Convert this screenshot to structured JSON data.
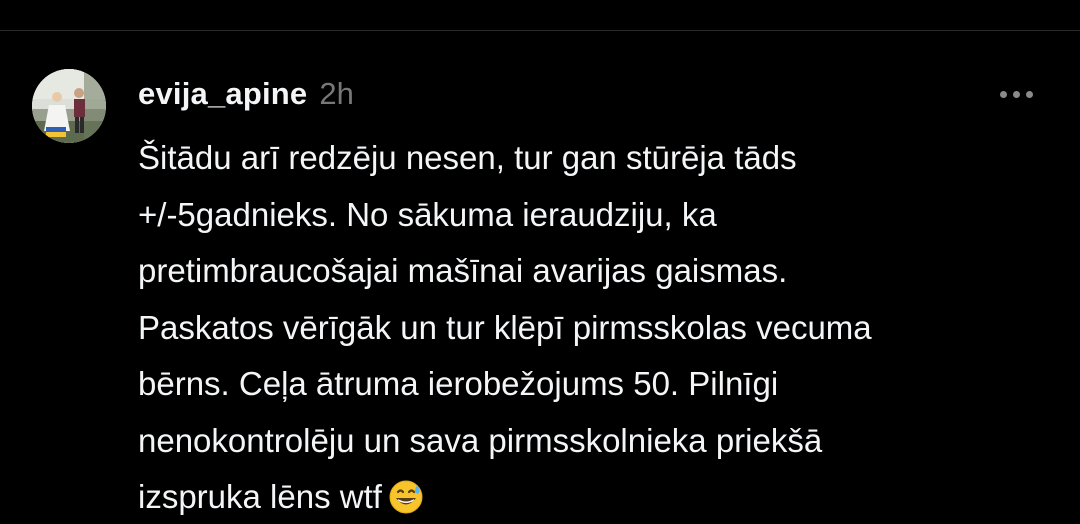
{
  "post": {
    "username": "evija_apine",
    "timestamp": "2h",
    "comment_lines": [
      "Šitādu arī redzēju nesen, tur gan stūrēja tāds",
      "+/-5gadnieks. No sākuma ieraudziju, ka",
      "pretimbraucošajai mašīnai avarijas gaismas.",
      "Paskatos vērīgāk un tur klēpī pirmsskolas vecuma",
      "bērns. Ceļa ātruma ierobežojums 50. Pilnīgi",
      "nenokontrolēju un sava pirmsskolnieka priekšā",
      "izspruka lēns wtf"
    ],
    "emoji": "grinning-face-with-sweat"
  },
  "icons": {
    "more": "more-horizontal-icon",
    "avatar": "user-avatar-photo"
  },
  "colors": {
    "background": "#000000",
    "text": "#f3f5f7",
    "muted": "#777777",
    "divider": "#2a2a2a"
  }
}
